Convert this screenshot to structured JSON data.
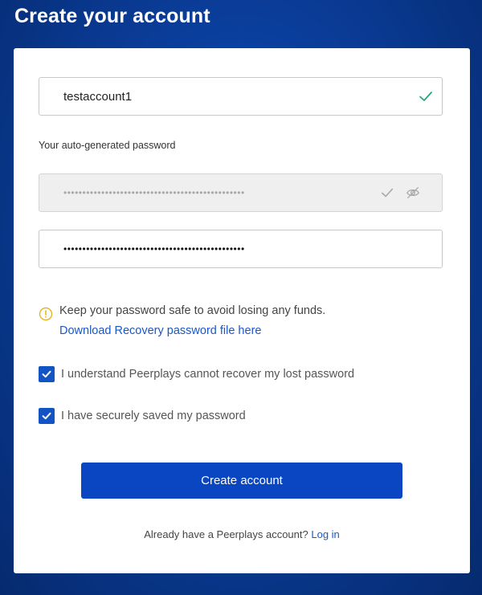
{
  "page": {
    "title": "Create your account"
  },
  "form": {
    "username_value": "testaccount1",
    "generated_label": "Your auto-generated password",
    "generated_password_value": "••••••••••••••••••••••••••••••••••••••••••••••••",
    "confirm_password_value": "••••••••••••••••••••••••••••••••••••••••••••••••",
    "info_text": "Keep your password safe to avoid losing any funds.",
    "download_link": "Download Recovery password file here",
    "checkbox_1_label": "I understand Peerplays cannot recover my lost password",
    "checkbox_1_checked": true,
    "checkbox_2_label": "I have securely saved my password",
    "checkbox_2_checked": true,
    "submit_label": "Create account",
    "footer_text": "Already have a Peerplays account?",
    "login_link": "Log in"
  },
  "icons": {
    "username_status": "check-icon",
    "generated_status": "check-icon",
    "visibility": "eye-off-icon",
    "info": "info-icon",
    "checkbox": "checkmark-icon"
  },
  "colors": {
    "background": "#0a3d9a",
    "accent": "#0a45c2",
    "link": "#1a57c7",
    "success": "#2aa876",
    "warning": "#e6b422"
  }
}
